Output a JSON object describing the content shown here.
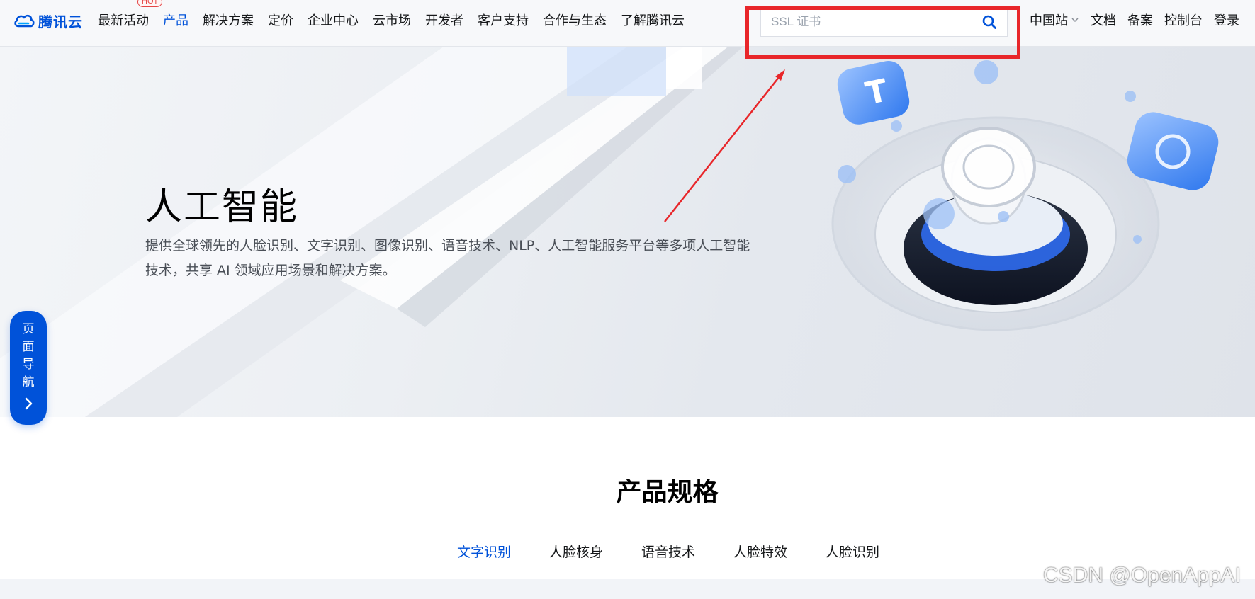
{
  "brand": {
    "name": "腾讯云",
    "color": "#0052d9"
  },
  "nav": {
    "items": [
      {
        "label": "最新活动",
        "badge": "HOT",
        "active": false
      },
      {
        "label": "产品",
        "active": true
      },
      {
        "label": "解决方案",
        "active": false
      },
      {
        "label": "定价",
        "active": false
      },
      {
        "label": "企业中心",
        "active": false
      },
      {
        "label": "云市场",
        "active": false
      },
      {
        "label": "开发者",
        "active": false
      },
      {
        "label": "客户支持",
        "active": false
      },
      {
        "label": "合作与生态",
        "active": false
      },
      {
        "label": "了解腾讯云",
        "active": false
      }
    ],
    "search": {
      "placeholder": "SSL 证书",
      "icon": "search-icon"
    },
    "right": {
      "region": "中国站",
      "docs": "文档",
      "beian": "备案",
      "console": "控制台",
      "login": "登录"
    }
  },
  "hero": {
    "title": "人工智能",
    "description": "提供全球领先的人脸识别、文字识别、图像识别、语音技术、NLP、人工智能服务平台等多项人工智能技术，共享 AI 领域应用场景和解决方案。"
  },
  "page_nav": {
    "chars": [
      "页",
      "面",
      "导",
      "航"
    ],
    "icon": "chevron-right-icon"
  },
  "specs": {
    "title": "产品规格",
    "tabs": [
      {
        "label": "文字识别",
        "active": true
      },
      {
        "label": "人脸核身",
        "active": false
      },
      {
        "label": "语音技术",
        "active": false
      },
      {
        "label": "人脸特效",
        "active": false
      },
      {
        "label": "人脸识别",
        "active": false
      }
    ]
  },
  "annotation": {
    "color": "#e8262a"
  },
  "watermark": "CSDN @OpenAppAI"
}
